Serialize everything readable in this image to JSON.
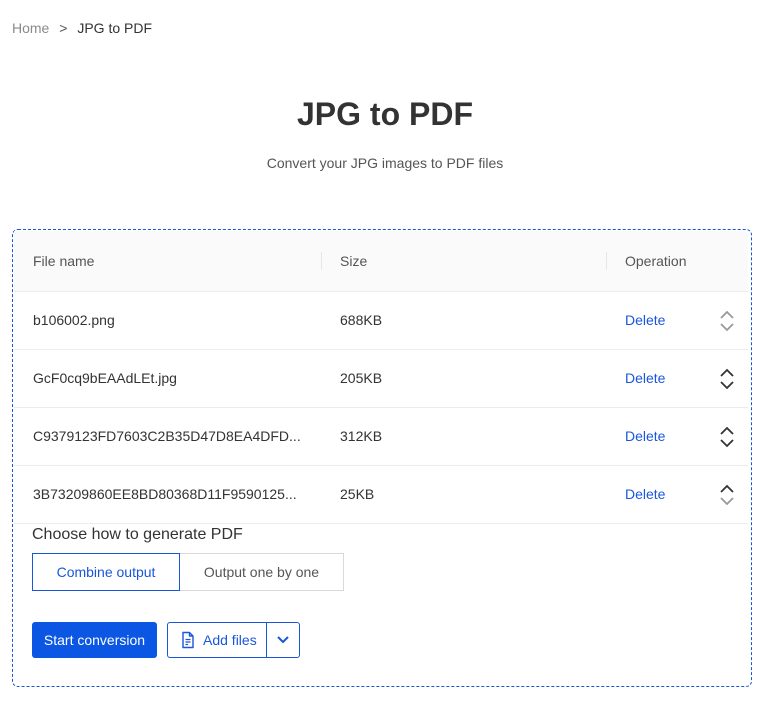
{
  "breadcrumb": {
    "home": "Home",
    "separator": ">",
    "current": "JPG to PDF"
  },
  "page": {
    "title": "JPG to PDF",
    "subtitle": "Convert your JPG images to PDF files"
  },
  "table": {
    "headers": {
      "name": "File name",
      "size": "Size",
      "operation": "Operation"
    },
    "rows": [
      {
        "name": "b106002.png",
        "size": "688KB",
        "action": "Delete"
      },
      {
        "name": "GcF0cq9bEAAdLEt.jpg",
        "size": "205KB",
        "action": "Delete"
      },
      {
        "name": "C9379123FD7603C2B35D47D8EA4DFD...",
        "size": "312KB",
        "action": "Delete"
      },
      {
        "name": "3B73209860EE8BD80368D11F9590125...",
        "size": "25KB",
        "action": "Delete"
      }
    ]
  },
  "options": {
    "label": "Choose how to generate PDF",
    "modes": [
      "Combine output",
      "Output one by one"
    ],
    "selected": "Combine output"
  },
  "actions": {
    "start": "Start conversion",
    "add_files": "Add files"
  },
  "icons": {
    "sort": "sort-arrows-icon",
    "file": "file-add-icon",
    "dropdown": "chevron-down-icon"
  },
  "colors": {
    "accent": "#1a56db",
    "primary_button": "#0b57e4"
  }
}
